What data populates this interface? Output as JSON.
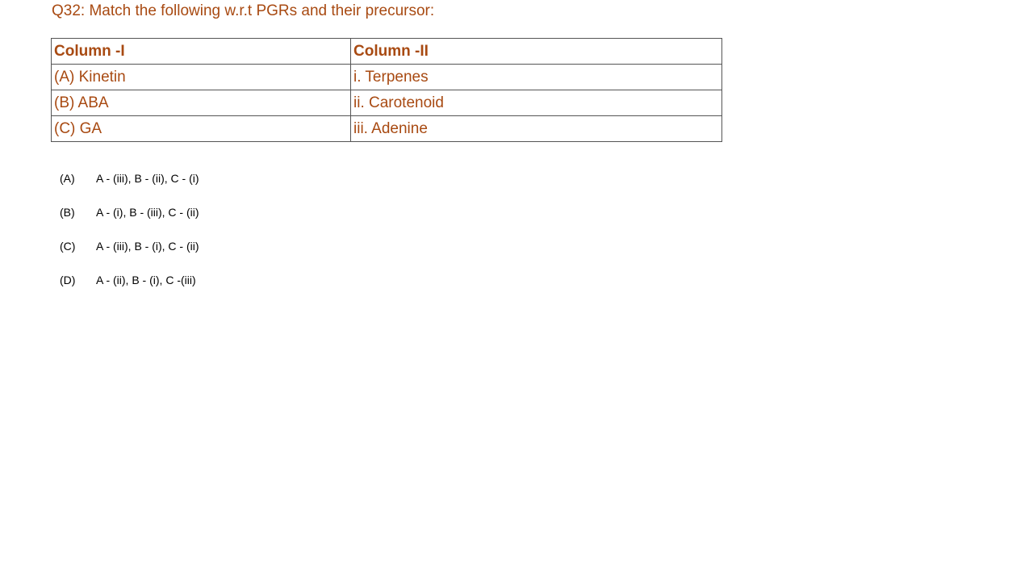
{
  "question": "Q32: Match the following w.r.t PGRs and their precursor:",
  "table": {
    "header": [
      "Column -I",
      "Column -II"
    ],
    "rows": [
      [
        "(A) Kinetin",
        "i. Terpenes"
      ],
      [
        "(B) ABA",
        "ii. Carotenoid"
      ],
      [
        "(C) GA",
        "iii. Adenine"
      ]
    ]
  },
  "options": [
    {
      "letter": "(A)",
      "text": "A - (iii), B - (ii), C - (i)"
    },
    {
      "letter": "(B)",
      "text": "A - (i), B - (iii), C - (ii)"
    },
    {
      "letter": "(C)",
      "text": "A - (iii), B - (i), C - (ii)"
    },
    {
      "letter": "(D)",
      "text": "A - (ii), B - (i), C -(iii)"
    }
  ],
  "colors": {
    "accent_text": "#a84a12",
    "border": "#555555",
    "body_text": "#000000"
  }
}
